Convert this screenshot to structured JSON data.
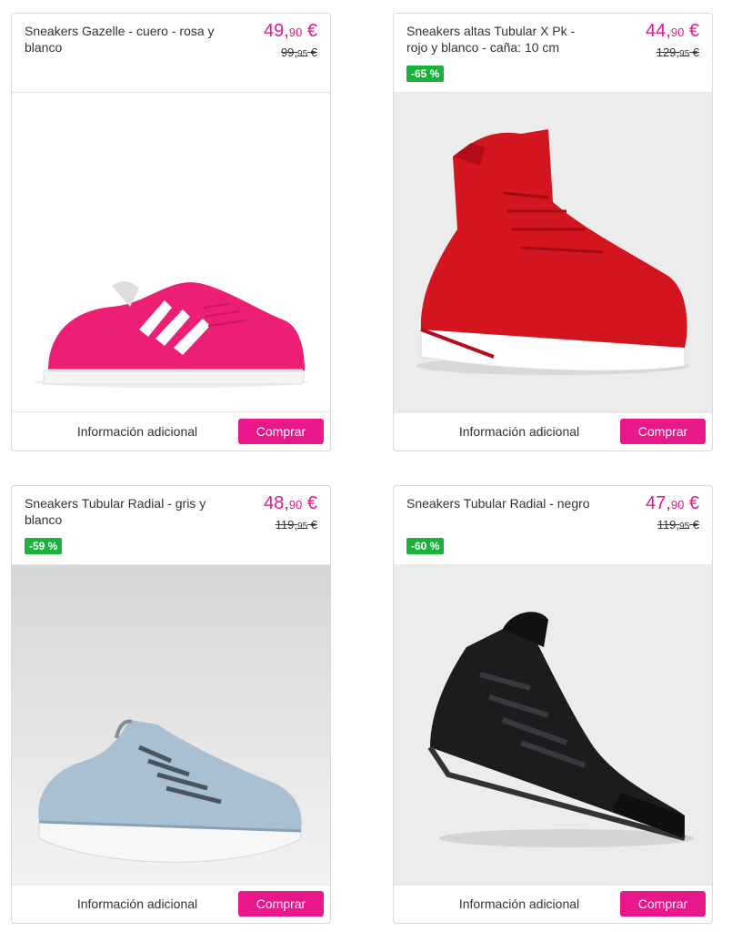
{
  "products": [
    {
      "title": "Sneakers Gazelle - cuero - rosa y blanco",
      "price_int": "49,",
      "price_cents": "90",
      "price_cur": " €",
      "old_int": "99,",
      "old_cents": "95",
      "old_cur": " €",
      "badge": "",
      "image_icon": "pink-sneaker-icon",
      "info_label": "Información adicional",
      "buy_label": "Comprar"
    },
    {
      "title": "Sneakers altas Tubular X Pk - rojo y blanco - caña: 10 cm",
      "price_int": "44,",
      "price_cents": "90",
      "price_cur": " €",
      "old_int": "129,",
      "old_cents": "95",
      "old_cur": " €",
      "badge": "-65 %",
      "image_icon": "red-sneaker-icon",
      "info_label": "Información adicional",
      "buy_label": "Comprar"
    },
    {
      "title": "Sneakers Tubular Radial - gris y blanco",
      "price_int": "48,",
      "price_cents": "90",
      "price_cur": " €",
      "old_int": "119,",
      "old_cents": "95",
      "old_cur": " €",
      "badge": "-59 %",
      "image_icon": "grey-sneaker-icon",
      "info_label": "Información adicional",
      "buy_label": "Comprar"
    },
    {
      "title": "Sneakers Tubular Radial - negro",
      "price_int": "47,",
      "price_cents": "90",
      "price_cur": " €",
      "old_int": "119,",
      "old_cents": "95",
      "old_cur": " €",
      "badge": "-60 %",
      "image_icon": "black-sneaker-icon",
      "info_label": "Información adicional",
      "buy_label": "Comprar"
    }
  ],
  "colors": {
    "accent": "#e8178a",
    "discount": "#19b23b"
  }
}
